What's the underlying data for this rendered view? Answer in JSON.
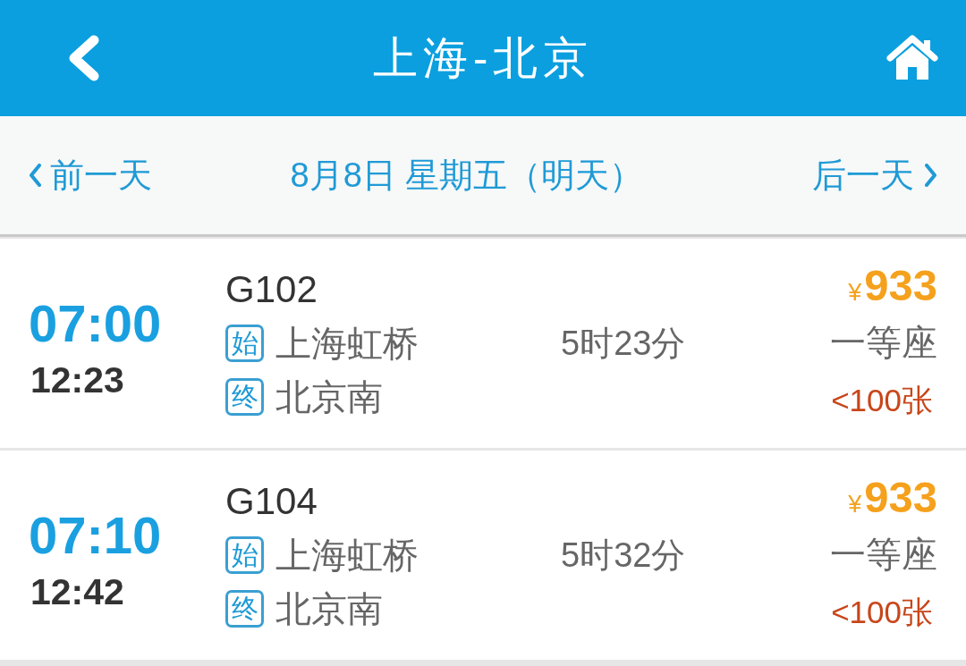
{
  "header": {
    "title": "上海-北京"
  },
  "date_bar": {
    "previous": "前一天",
    "current": "8月8日 星期五（明天）",
    "next": "后一天"
  },
  "trains": [
    {
      "departure": "07:00",
      "arrival": "12:23",
      "train_no": "G102",
      "origin_tag": "始",
      "origin": "上海虹桥",
      "destination_tag": "终",
      "destination": "北京南",
      "duration": "5时23分",
      "currency": "¥",
      "price": "933",
      "seat_class": "一等座",
      "availability": "<100张"
    },
    {
      "departure": "07:10",
      "arrival": "12:42",
      "train_no": "G104",
      "origin_tag": "始",
      "origin": "上海虹桥",
      "destination_tag": "终",
      "destination": "北京南",
      "duration": "5时32分",
      "currency": "¥",
      "price": "933",
      "seat_class": "一等座",
      "availability": "<100张"
    }
  ]
}
